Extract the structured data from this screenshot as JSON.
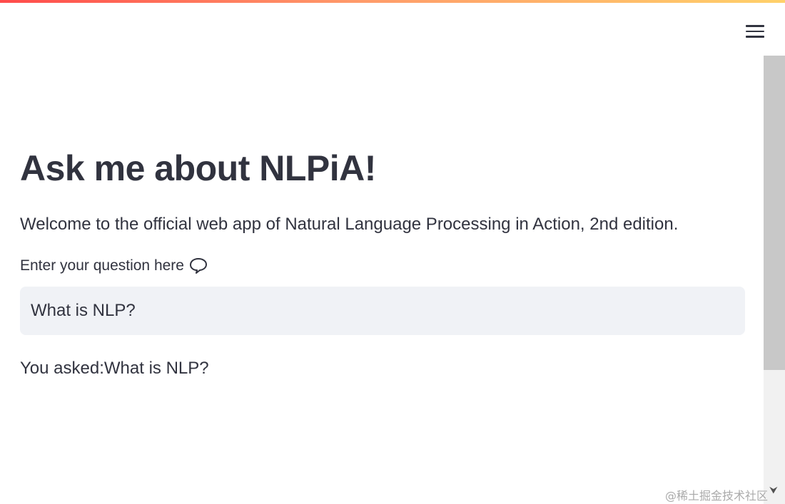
{
  "header": {
    "menu_icon": "hamburger-menu-icon"
  },
  "main": {
    "title": "Ask me about NLPiA!",
    "welcome_text": "Welcome to the official web app of Natural Language Processing in Action, 2nd edition.",
    "question_label": "Enter your question here",
    "question_icon": "speech-bubble-icon",
    "question_value": "What is NLP?",
    "answer_prefix": "You asked:",
    "answer_value": "What is NLP?"
  },
  "watermark": {
    "text": "@稀土掘金技术社区"
  },
  "scrollbar": {
    "position_fraction": 0
  },
  "colors": {
    "accent_start": "#ff4b4b",
    "accent_end": "#ffd16a",
    "text": "#31333f",
    "input_background": "#f0f2f6"
  }
}
